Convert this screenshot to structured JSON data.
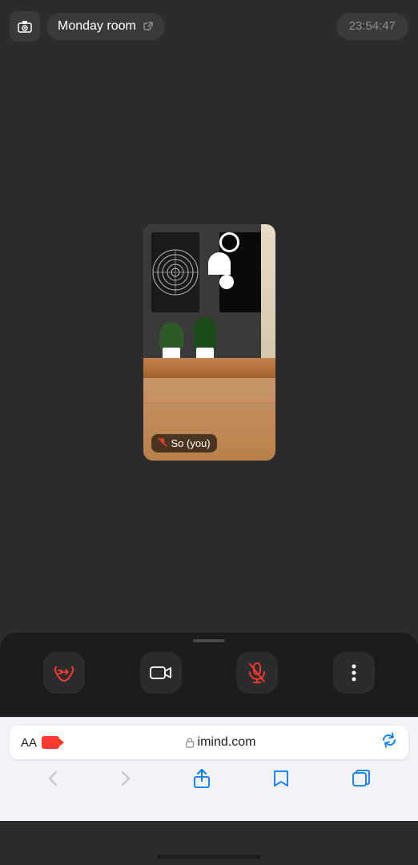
{
  "header": {
    "room_name": "Monday room",
    "timer": "23:54:47",
    "camera_icon": "📷",
    "link_icon": "🔗"
  },
  "video": {
    "participant_name": "So  (you)",
    "mic_muted": true
  },
  "controls": {
    "leave_icon": "🚪",
    "camera_icon": "📹",
    "mic_icon": "🎙️",
    "more_icon": "⋮"
  },
  "page_dots": [
    "dot",
    "dot-active",
    "dot"
  ],
  "browser": {
    "aa_label": "AA",
    "lock_icon": "🔒",
    "domain": "imind.com",
    "refresh_tooltip": "Reload page"
  },
  "safari_nav": {
    "back": "‹",
    "forward": "›",
    "share": "share",
    "bookmarks": "bookmarks",
    "tabs": "tabs"
  }
}
